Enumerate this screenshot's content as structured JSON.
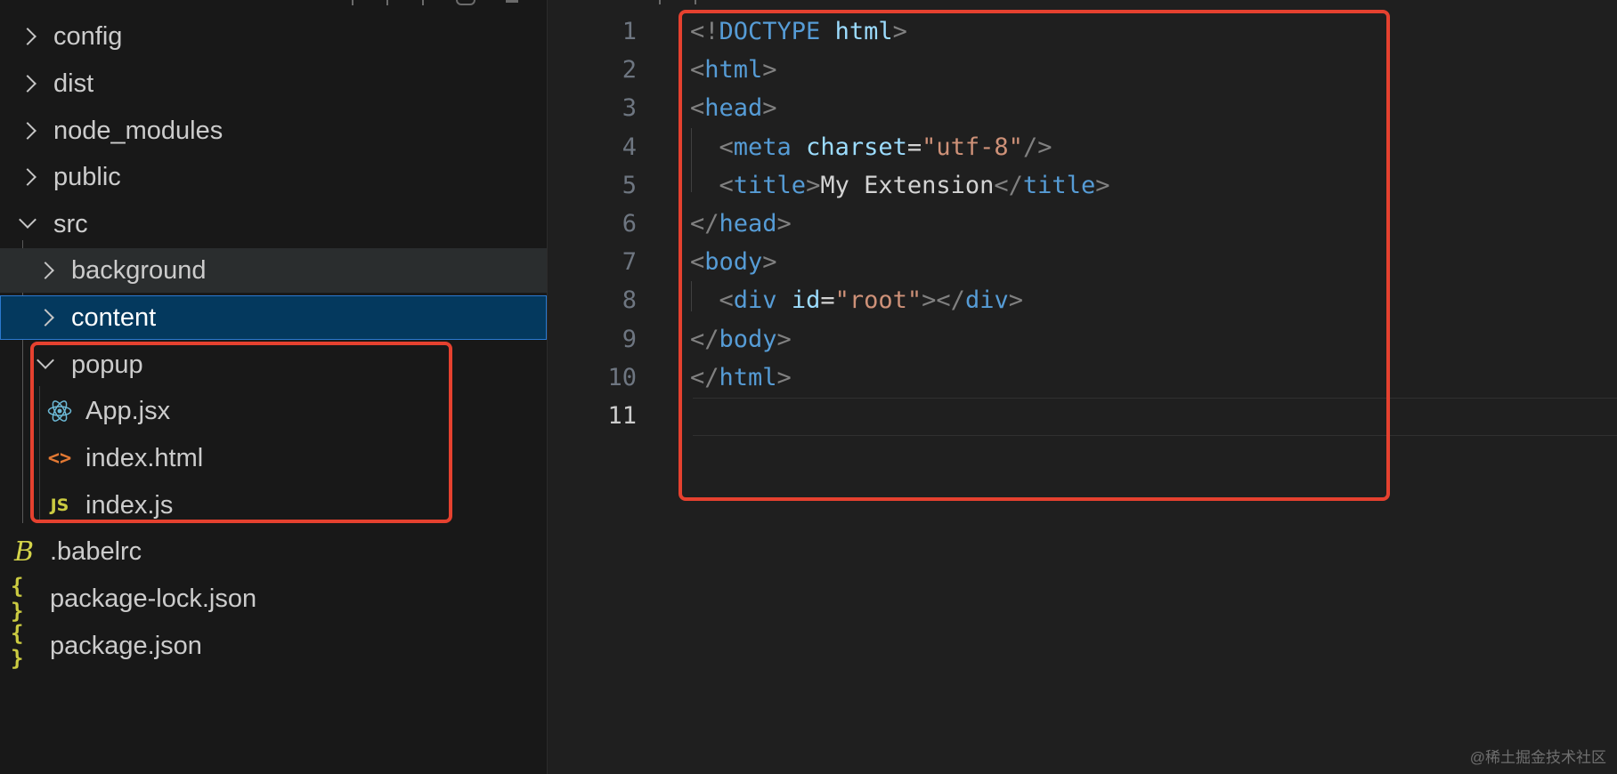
{
  "explorer": {
    "items": [
      {
        "label": "config",
        "kind": "folder",
        "state": "collapsed",
        "level": 0
      },
      {
        "label": "dist",
        "kind": "folder",
        "state": "collapsed",
        "level": 0
      },
      {
        "label": "node_modules",
        "kind": "folder",
        "state": "collapsed",
        "level": 0
      },
      {
        "label": "public",
        "kind": "folder",
        "state": "collapsed",
        "level": 0
      },
      {
        "label": "src",
        "kind": "folder",
        "state": "expanded",
        "level": 0
      },
      {
        "label": "background",
        "kind": "folder",
        "state": "collapsed",
        "level": 1
      },
      {
        "label": "content",
        "kind": "folder",
        "state": "collapsed",
        "level": 1
      },
      {
        "label": "popup",
        "kind": "folder",
        "state": "expanded",
        "level": 1
      },
      {
        "label": "App.jsx",
        "kind": "file",
        "icon": "react-icon",
        "level": 2
      },
      {
        "label": "index.html",
        "kind": "file",
        "icon": "html-file-icon",
        "level": 2
      },
      {
        "label": "index.js",
        "kind": "file",
        "icon": "js-file-icon",
        "level": 2
      },
      {
        "label": ".babelrc",
        "kind": "file",
        "icon": "babel-file-icon",
        "level": 0
      },
      {
        "label": "package-lock.json",
        "kind": "file",
        "icon": "json-file-icon",
        "level": 0
      },
      {
        "label": "package.json",
        "kind": "file",
        "icon": "json-file-icon",
        "level": 0
      }
    ],
    "icon_glyphs": {
      "html": "<>",
      "js": "JS",
      "json": "{ }",
      "babel": "B"
    }
  },
  "editor": {
    "active_line": "11",
    "line_numbers": [
      "1",
      "2",
      "3",
      "4",
      "5",
      "6",
      "7",
      "8",
      "9",
      "10",
      "11"
    ],
    "lines": [
      [
        {
          "t": "punc",
          "v": "<!"
        },
        {
          "t": "tag",
          "v": "DOCTYPE"
        },
        {
          "t": "text",
          "v": " "
        },
        {
          "t": "attr",
          "v": "html"
        },
        {
          "t": "punc",
          "v": ">"
        }
      ],
      [
        {
          "t": "punc",
          "v": "<"
        },
        {
          "t": "tag",
          "v": "html"
        },
        {
          "t": "punc",
          "v": ">"
        }
      ],
      [
        {
          "t": "punc",
          "v": "<"
        },
        {
          "t": "tag",
          "v": "head"
        },
        {
          "t": "punc",
          "v": ">"
        }
      ],
      [
        {
          "t": "text",
          "v": "  "
        },
        {
          "t": "punc",
          "v": "<"
        },
        {
          "t": "tag",
          "v": "meta"
        },
        {
          "t": "text",
          "v": " "
        },
        {
          "t": "attr",
          "v": "charset"
        },
        {
          "t": "text",
          "v": "="
        },
        {
          "t": "str",
          "v": "\"utf-8\""
        },
        {
          "t": "punc",
          "v": "/>"
        }
      ],
      [
        {
          "t": "text",
          "v": "  "
        },
        {
          "t": "punc",
          "v": "<"
        },
        {
          "t": "tag",
          "v": "title"
        },
        {
          "t": "punc",
          "v": ">"
        },
        {
          "t": "text",
          "v": "My Extension"
        },
        {
          "t": "punc",
          "v": "</"
        },
        {
          "t": "tag",
          "v": "title"
        },
        {
          "t": "punc",
          "v": ">"
        }
      ],
      [
        {
          "t": "punc",
          "v": "</"
        },
        {
          "t": "tag",
          "v": "head"
        },
        {
          "t": "punc",
          "v": ">"
        }
      ],
      [
        {
          "t": "punc",
          "v": "<"
        },
        {
          "t": "tag",
          "v": "body"
        },
        {
          "t": "punc",
          "v": ">"
        }
      ],
      [
        {
          "t": "text",
          "v": "  "
        },
        {
          "t": "punc",
          "v": "<"
        },
        {
          "t": "tag",
          "v": "div"
        },
        {
          "t": "text",
          "v": " "
        },
        {
          "t": "attr",
          "v": "id"
        },
        {
          "t": "text",
          "v": "="
        },
        {
          "t": "str",
          "v": "\"root\""
        },
        {
          "t": "punc",
          "v": "></"
        },
        {
          "t": "tag",
          "v": "div"
        },
        {
          "t": "punc",
          "v": ">"
        }
      ],
      [
        {
          "t": "punc",
          "v": "</"
        },
        {
          "t": "tag",
          "v": "body"
        },
        {
          "t": "punc",
          "v": ">"
        }
      ],
      [
        {
          "t": "punc",
          "v": "</"
        },
        {
          "t": "tag",
          "v": "html"
        },
        {
          "t": "punc",
          "v": ">"
        }
      ],
      []
    ]
  },
  "watermark": "@稀土掘金技术社区",
  "colors": {
    "highlight_box": "#e5412f",
    "selection": "#04395e",
    "tag": "#569cd6",
    "attribute": "#9cdcfe",
    "string": "#ce9178"
  }
}
